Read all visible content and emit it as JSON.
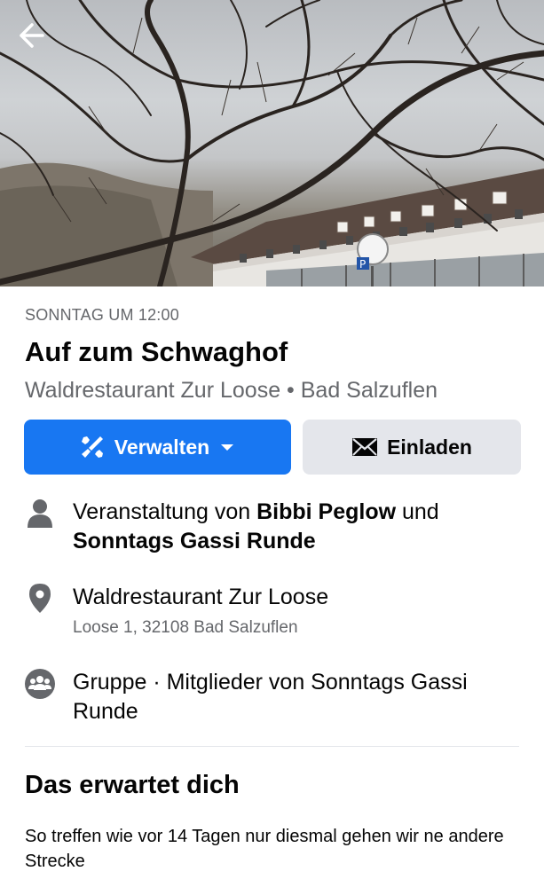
{
  "cover": {
    "back_icon": "arrow-left-icon",
    "sign_letter": "P"
  },
  "event": {
    "date": "SONNTAG UM 12:00",
    "title": "Auf zum Schwaghof",
    "location_line": "Waldrestaurant Zur Loose • Bad Salzuflen"
  },
  "actions": {
    "manage_label": "Verwalten",
    "manage_icon": "tools-icon",
    "invite_label": "Einladen",
    "invite_icon": "envelope-icon"
  },
  "details": {
    "host_prefix": "Veranstaltung von ",
    "host_name": "Bibbi Peglow",
    "host_joiner": " und ",
    "host_group": "Sonntags Gassi Runde",
    "venue_name": "Waldrestaurant Zur Loose",
    "venue_address": "Loose 1, 32108 Bad Salzuflen",
    "privacy": "Gruppe · Mitglieder von Sonntags Gassi Runde"
  },
  "about": {
    "heading": "Das erwartet dich",
    "text": "So treffen wie vor 14 Tagen nur diesmal gehen wir ne andere Strecke"
  },
  "colors": {
    "primary": "#1877f2",
    "secondary_bg": "#e4e6eb",
    "muted_text": "#65676b",
    "icon_gray": "#65676b"
  }
}
